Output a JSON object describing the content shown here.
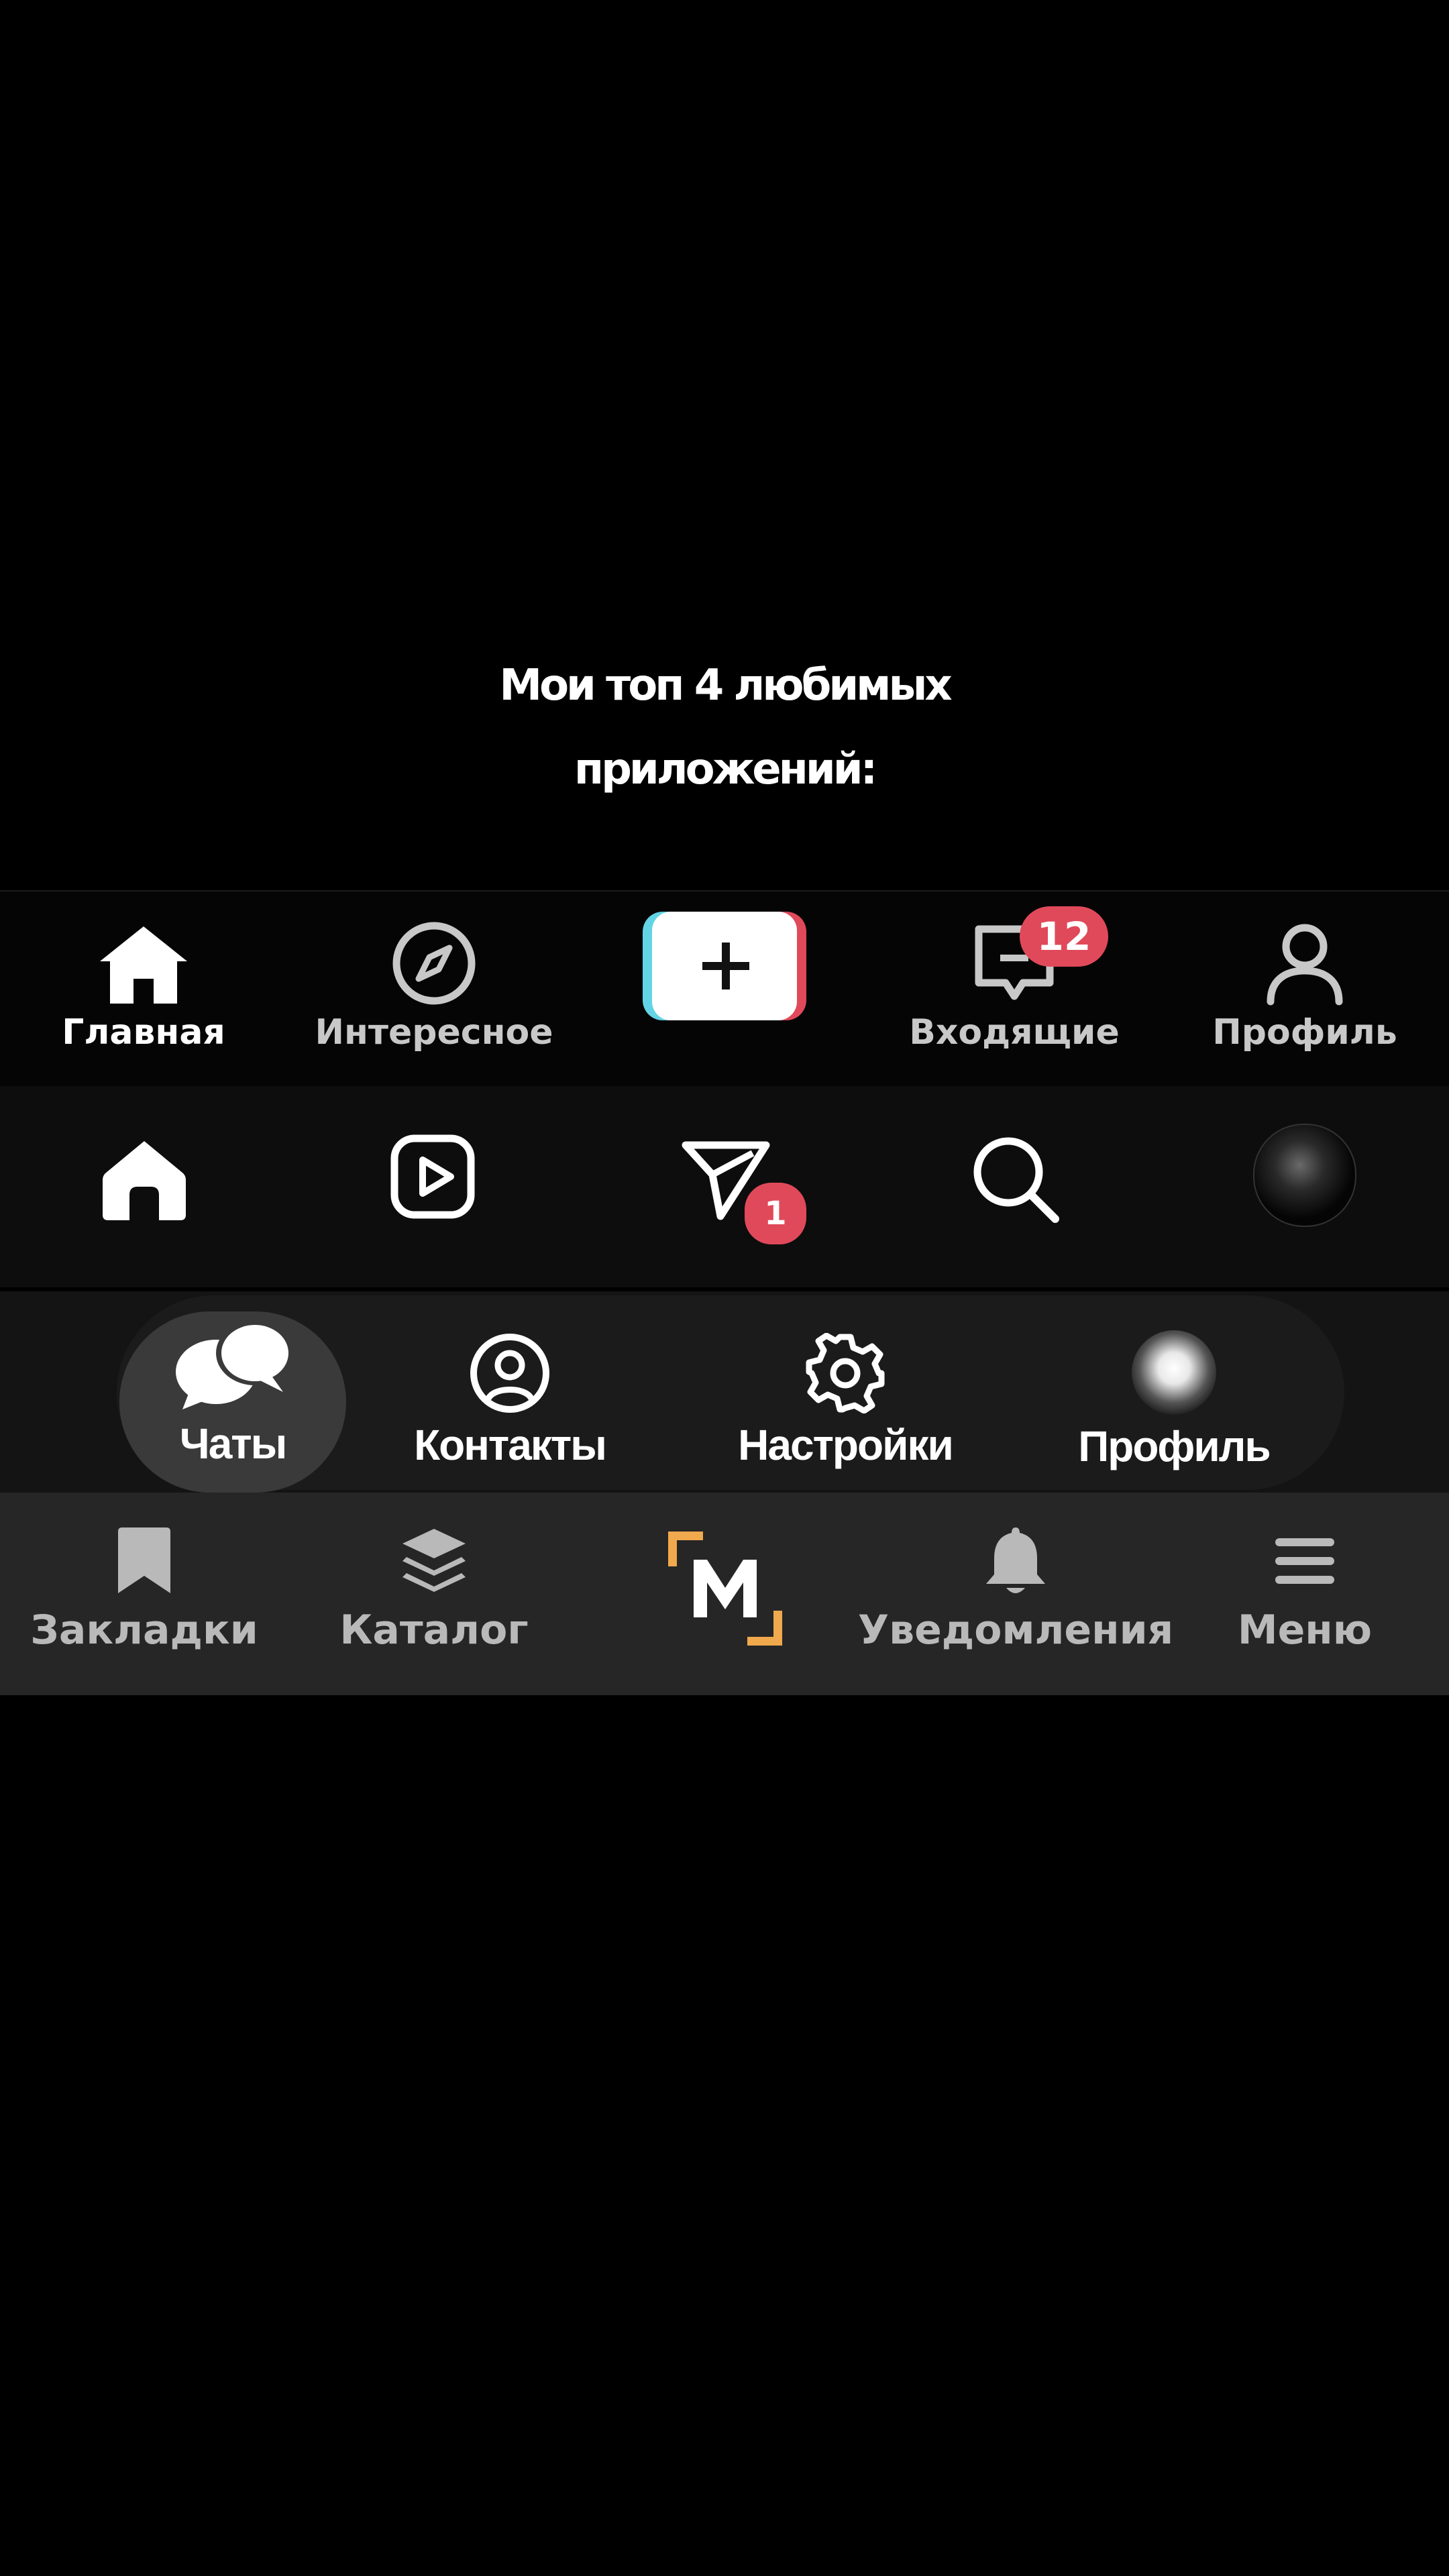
{
  "caption": {
    "line1": "Мои топ 4 любимых",
    "line2": "приложений:"
  },
  "tiktok_bar": {
    "items": [
      {
        "label": "Главная",
        "icon": "home-icon"
      },
      {
        "label": "Интересное",
        "icon": "compass-icon"
      },
      {
        "label": "",
        "icon": "plus-icon"
      },
      {
        "label": "Входящие",
        "icon": "inbox-icon",
        "badge": "12"
      },
      {
        "label": "Профиль",
        "icon": "person-icon"
      }
    ],
    "colors": {
      "badge": "#e0495a",
      "plus_left": "#63d4e6",
      "plus_right": "#e0495a"
    }
  },
  "instagram_bar": {
    "items": [
      {
        "icon": "home-icon"
      },
      {
        "icon": "reels-icon"
      },
      {
        "icon": "send-icon",
        "badge": "1"
      },
      {
        "icon": "search-icon"
      },
      {
        "icon": "avatar"
      }
    ]
  },
  "telegram_bar": {
    "items": [
      {
        "label": "Чаты",
        "icon": "chats-icon"
      },
      {
        "label": "Контакты",
        "icon": "contacts-icon"
      },
      {
        "label": "Настройки",
        "icon": "settings-icon"
      },
      {
        "label": "Профиль",
        "icon": "avatar"
      }
    ]
  },
  "manga_bar": {
    "items": [
      {
        "label": "Закладки",
        "icon": "bookmark-icon"
      },
      {
        "label": "Каталог",
        "icon": "layers-icon"
      },
      {
        "label": "",
        "icon": "logo-m"
      },
      {
        "label": "Уведомления",
        "icon": "bell-icon"
      },
      {
        "label": "Меню",
        "icon": "menu-icon"
      }
    ],
    "colors": {
      "logo_accent": "#f0a94c"
    }
  }
}
